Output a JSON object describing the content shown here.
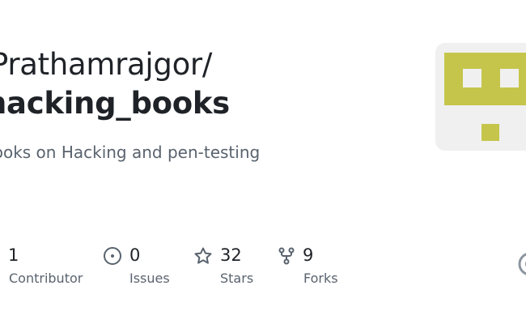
{
  "repo": {
    "owner": "Prathamrajgor/",
    "name": "hacking_books",
    "description": "Books on Hacking and pen-testing"
  },
  "avatar": {
    "icon": "identicon",
    "colors": [
      "#c5c54c",
      "#f0f0f0"
    ]
  },
  "stats": [
    {
      "icon": "people-icon",
      "value": "1",
      "label": "Contributor"
    },
    {
      "icon": "issue-icon",
      "value": "0",
      "label": "Issues"
    },
    {
      "icon": "star-icon",
      "value": "32",
      "label": "Stars"
    },
    {
      "icon": "fork-icon",
      "value": "9",
      "label": "Forks"
    }
  ],
  "edge_icon": "github-logo-icon"
}
